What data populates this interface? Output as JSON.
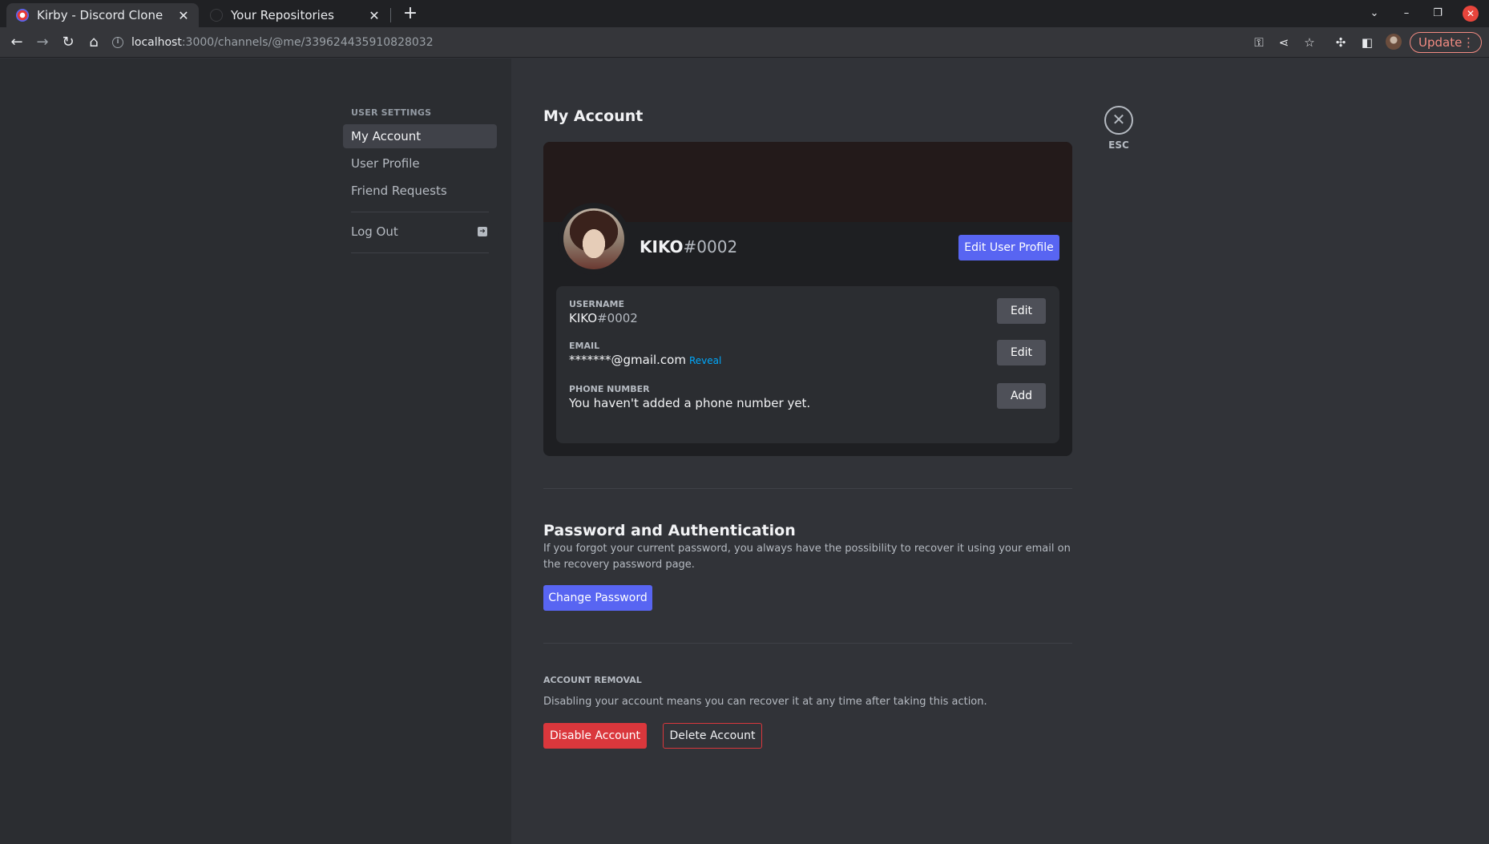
{
  "browser": {
    "tabs": [
      {
        "title": "Kirby - Discord Clone",
        "active": true,
        "favicon": "kirby-favicon"
      },
      {
        "title": "Your Repositories",
        "active": false,
        "favicon": "github-favicon"
      }
    ],
    "url_host": "localhost",
    "url_path": ":3000/channels/@me/339624435910828032",
    "update_label": "Update"
  },
  "sidebar": {
    "heading": "USER SETTINGS",
    "items": [
      {
        "label": "My Account",
        "active": true
      },
      {
        "label": "User Profile",
        "active": false
      },
      {
        "label": "Friend Requests",
        "active": false
      }
    ],
    "logout_label": "Log Out"
  },
  "account": {
    "page_title": "My Account",
    "username": "KIKO",
    "tag": "#0002",
    "edit_profile_label": "Edit User Profile",
    "fields": {
      "username_label": "USERNAME",
      "username_value": "KIKO",
      "username_tag": "#0002",
      "username_button": "Edit",
      "email_label": "EMAIL",
      "email_value": "*******@gmail.com",
      "email_reveal": "Reveal",
      "email_button": "Edit",
      "phone_label": "PHONE NUMBER",
      "phone_value": "You haven't added a phone number yet.",
      "phone_button": "Add"
    }
  },
  "close": {
    "label": "ESC"
  },
  "password": {
    "title": "Password and Authentication",
    "description": "If you forgot your current password, you always have the possibility to recover it using your email on the recovery password page.",
    "button": "Change Password"
  },
  "removal": {
    "heading": "ACCOUNT REMOVAL",
    "description": "Disabling your account means you can recover it at any time after taking this action.",
    "disable_button": "Disable Account",
    "delete_button": "Delete Account"
  },
  "colors": {
    "brand": "#5865f2",
    "danger": "#da373c",
    "link": "#00a8fc"
  }
}
